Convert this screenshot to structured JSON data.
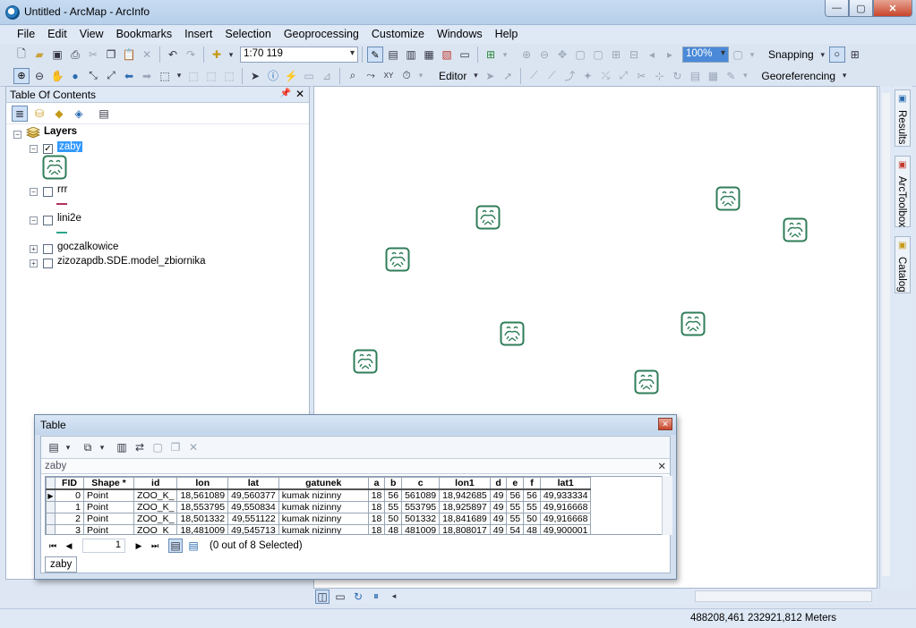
{
  "window": {
    "title": "Untitled - ArcMap - ArcInfo",
    "min": "—",
    "max": "▢",
    "close": "✕"
  },
  "menu": [
    "File",
    "Edit",
    "View",
    "Bookmarks",
    "Insert",
    "Selection",
    "Geoprocessing",
    "Customize",
    "Windows",
    "Help"
  ],
  "toolbar": {
    "scale": "1:70 119",
    "zoom": "100%",
    "snapping": "Snapping",
    "editor": "Editor",
    "georeferencing": "Georeferencing"
  },
  "toc": {
    "title": "Table Of Contents",
    "layers_label": "Layers",
    "layers": [
      {
        "name": "zaby",
        "checked": true,
        "selected": true,
        "expanded": true
      },
      {
        "name": "rrr",
        "checked": false,
        "expanded": true
      },
      {
        "name": "lini2e",
        "checked": false,
        "expanded": true
      },
      {
        "name": "goczalkowice",
        "checked": false,
        "expanded": false
      },
      {
        "name": "zizozapdb.SDE.model_zbiornika",
        "checked": false,
        "expanded": false
      }
    ]
  },
  "side_tabs": [
    "Results",
    "ArcToolbox",
    "Catalog"
  ],
  "map": {
    "feature_symbol": "frog-marker-icon",
    "feature_count": 8
  },
  "table": {
    "title": "Table",
    "layer_tab": "zaby",
    "columns": [
      "FID",
      "Shape *",
      "id",
      "lon",
      "lat",
      "gatunek",
      "a",
      "b",
      "c",
      "lon1",
      "d",
      "e",
      "f",
      "lat1"
    ],
    "rows": [
      [
        "0",
        "Point",
        "ZOO_K_",
        "18,561089",
        "49,560377",
        "kumak nizinny",
        "18",
        "56",
        "561089",
        "18,942685",
        "49",
        "56",
        "56",
        "49,933334"
      ],
      [
        "1",
        "Point",
        "ZOO_K_",
        "18,553795",
        "49,550834",
        "kumak nizinny",
        "18",
        "55",
        "553795",
        "18,925897",
        "49",
        "55",
        "55",
        "49,916668"
      ],
      [
        "2",
        "Point",
        "ZOO_K_",
        "18,501332",
        "49,551122",
        "kumak nizinny",
        "18",
        "50",
        "501332",
        "18,841689",
        "49",
        "55",
        "50",
        "49,916668"
      ],
      [
        "3",
        "Point",
        "ZOO_K_",
        "18,481009",
        "49,545713",
        "kumak nizinny",
        "18",
        "48",
        "481009",
        "18,808017",
        "49",
        "54",
        "48",
        "49,900001"
      ]
    ],
    "current_record": "1",
    "selection_status": "(0 out of 8 Selected)",
    "bottom_tab": "zaby"
  },
  "status": {
    "coordinates": "488208,461  232921,812 Meters"
  }
}
